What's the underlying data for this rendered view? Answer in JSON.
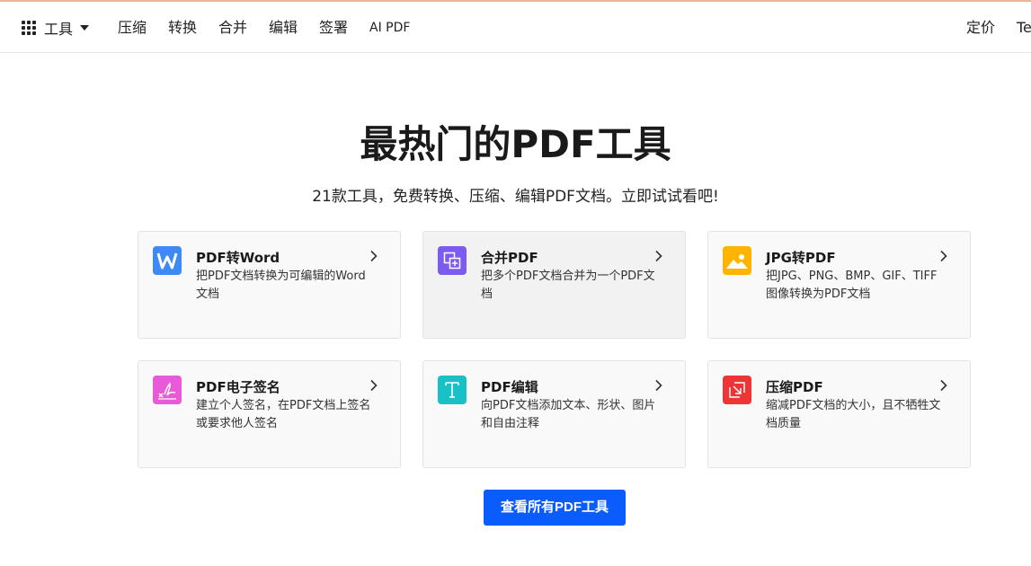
{
  "nav": {
    "tools_label": "工具",
    "links": [
      "压缩",
      "转换",
      "合并",
      "编辑",
      "签署",
      "AI PDF"
    ],
    "pricing": "定价",
    "team": "Te"
  },
  "hero": {
    "title": "最热门的PDF工具",
    "subtitle": "21款工具，免费转换、压缩、编辑PDF文档。立即试试看吧!"
  },
  "cards": [
    {
      "title": "PDF转Word",
      "desc": "把PDF文档转换为可编辑的Word文档",
      "icon": "word-icon",
      "color": "#3d8af7"
    },
    {
      "title": "合并PDF",
      "desc": "把多个PDF文档合并为一个PDF文档",
      "icon": "merge-icon",
      "color": "#7c5cf0"
    },
    {
      "title": "JPG转PDF",
      "desc": "把JPG、PNG、BMP、GIF、TIFF图像转换为PDF文档",
      "icon": "image-icon",
      "color": "#ffb400"
    },
    {
      "title": "PDF电子签名",
      "desc": "建立个人签名，在PDF文档上签名或要求他人签名",
      "icon": "signature-icon",
      "color": "#e85ad8"
    },
    {
      "title": "PDF编辑",
      "desc": "向PDF文档添加文本、形状、图片和自由注释",
      "icon": "text-edit-icon",
      "color": "#19c1c7"
    },
    {
      "title": "压缩PDF",
      "desc": "缩减PDF文档的大小，且不牺牲文档质量",
      "icon": "compress-icon",
      "color": "#ee3434"
    }
  ],
  "cta_label": "查看所有PDF工具"
}
